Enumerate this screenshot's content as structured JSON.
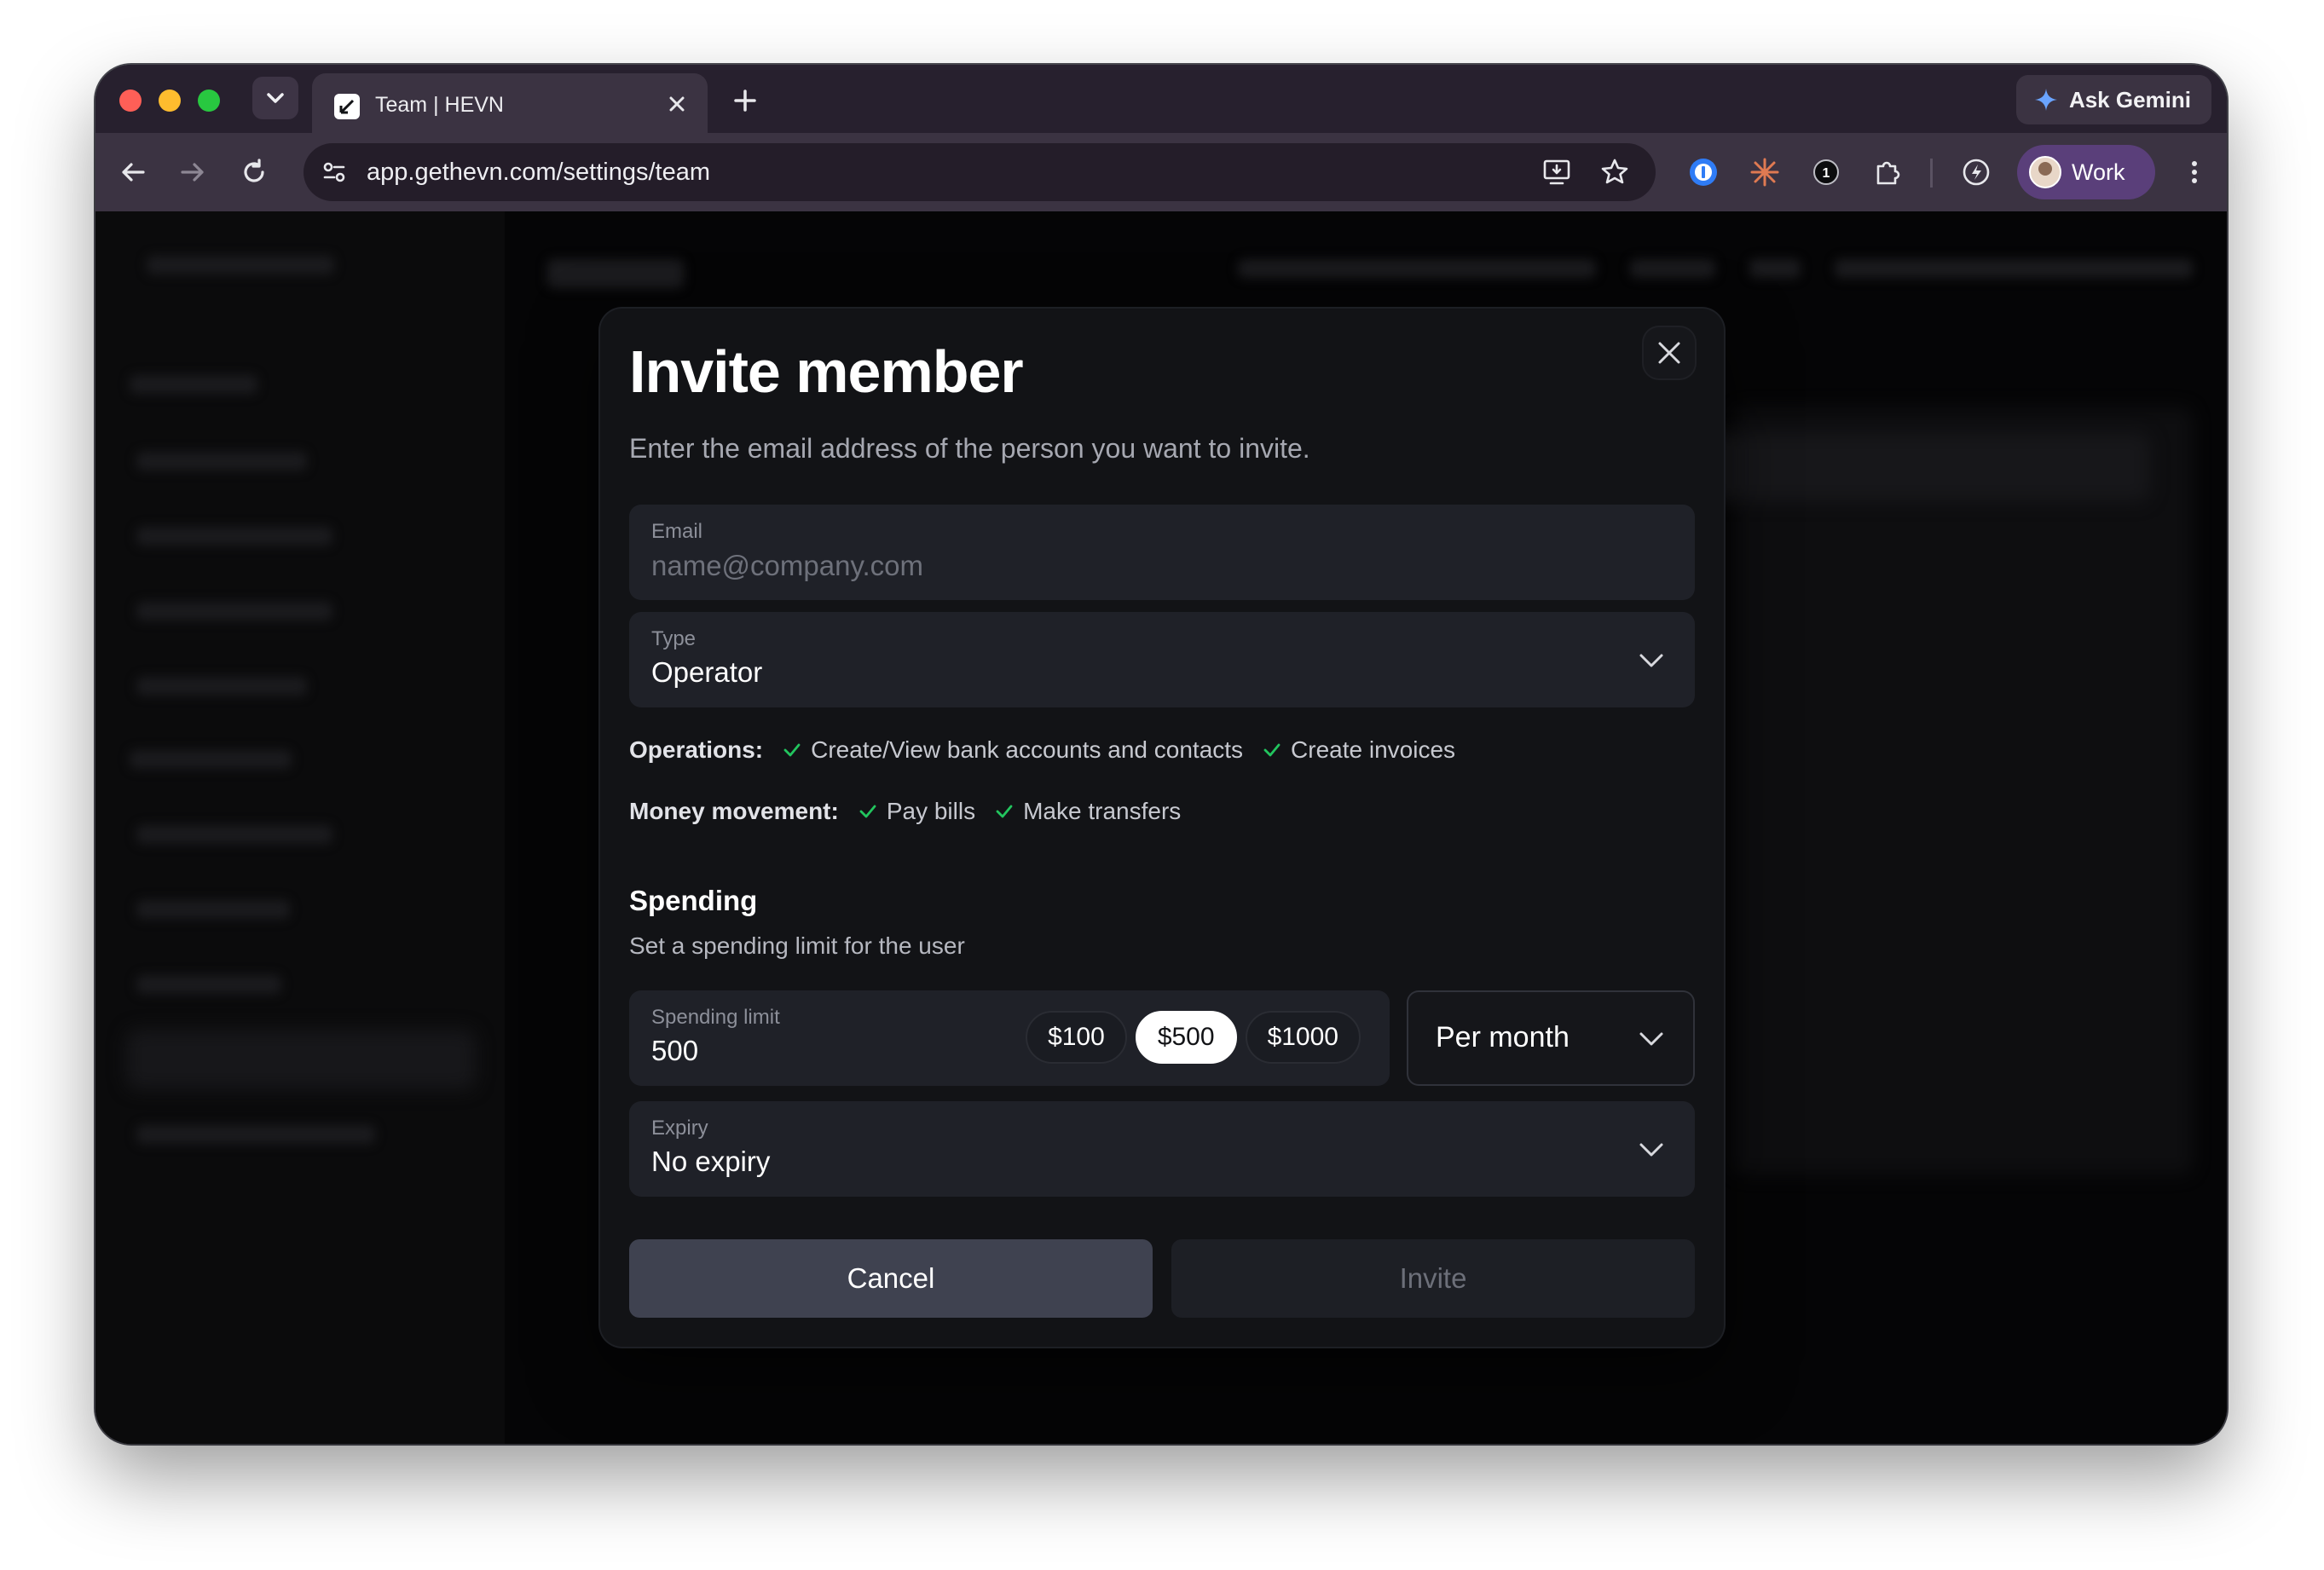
{
  "browser": {
    "tab_title": "Team | HEVN",
    "url": "app.gethevn.com/settings/team",
    "gemini_label": "Ask Gemini",
    "profile_label": "Work"
  },
  "modal": {
    "title": "Invite member",
    "subtitle": "Enter the email address of the person you want to invite.",
    "email": {
      "label": "Email",
      "placeholder": "name@company.com",
      "value": ""
    },
    "type": {
      "label": "Type",
      "value": "Operator"
    },
    "operations": {
      "label": "Operations:",
      "items": [
        "Create/View bank accounts and contacts",
        "Create invoices"
      ]
    },
    "money_movement": {
      "label": "Money movement:",
      "items": [
        "Pay bills",
        "Make transfers"
      ]
    },
    "spending": {
      "title": "Spending",
      "subtitle": "Set a spending limit for the user",
      "limit_label": "Spending limit",
      "limit_value": "500",
      "presets": [
        "$100",
        "$500",
        "$1000"
      ],
      "selected_preset": "$500",
      "period": "Per month"
    },
    "expiry": {
      "label": "Expiry",
      "value": "No expiry"
    },
    "cancel_label": "Cancel",
    "invite_label": "Invite"
  },
  "colors": {
    "accent": "#ffffff",
    "check": "#22c55e",
    "dialog_bg": "#121316",
    "field_bg": "#1f2128"
  }
}
